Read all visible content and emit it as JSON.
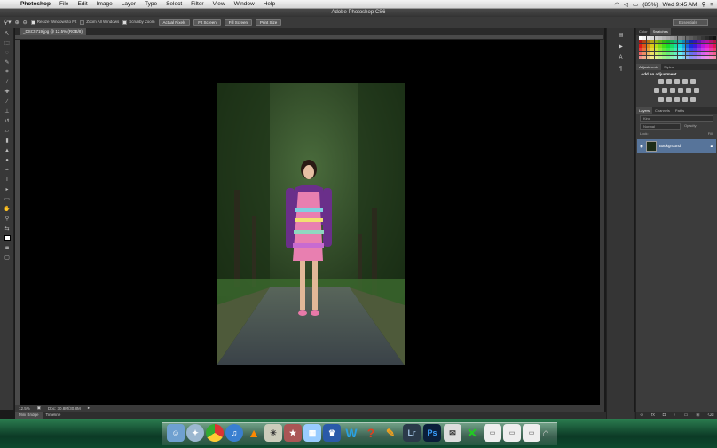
{
  "menubar": {
    "app": "Photoshop",
    "items": [
      "File",
      "Edit",
      "Image",
      "Layer",
      "Type",
      "Select",
      "Filter",
      "View",
      "Window",
      "Help"
    ],
    "battery": "(85%)",
    "clock": "Wed 9:45 AM"
  },
  "window": {
    "title": "Adobe Photoshop CS6"
  },
  "options": {
    "resize": "Resize Windows to Fit",
    "zoom_all": "Zoom All Windows",
    "scrubby": "Scrubby Zoom",
    "actual": "Actual Pixels",
    "fit": "Fit Screen",
    "fill": "Fill Screen",
    "print": "Print Size",
    "workspace": "Essentials"
  },
  "document": {
    "tab": "_DSC5719.jpg @ 12.5% (RGB/8)",
    "zoom": "12.5%",
    "docsize": "Doc: 30.8M/30.8M"
  },
  "bottom_tabs": [
    "Mini Bridge",
    "Timeline"
  ],
  "panels": {
    "color_tabs": [
      "Color",
      "Swatches"
    ],
    "adj_tabs": [
      "Adjustments",
      "Styles"
    ],
    "adj_title": "Add an adjustment",
    "layer_tabs": [
      "Layers",
      "Channels",
      "Paths"
    ],
    "kind": "Kind",
    "blend": "Normal",
    "opacity": "Opacity:",
    "lock": "Lock:",
    "fill": "Fill:",
    "layer_name": "Background"
  },
  "colors": {
    "accent_layer": "#57749a",
    "canvas": "#000000"
  },
  "dock": {
    "lr": "Lr",
    "ps": "Ps"
  }
}
